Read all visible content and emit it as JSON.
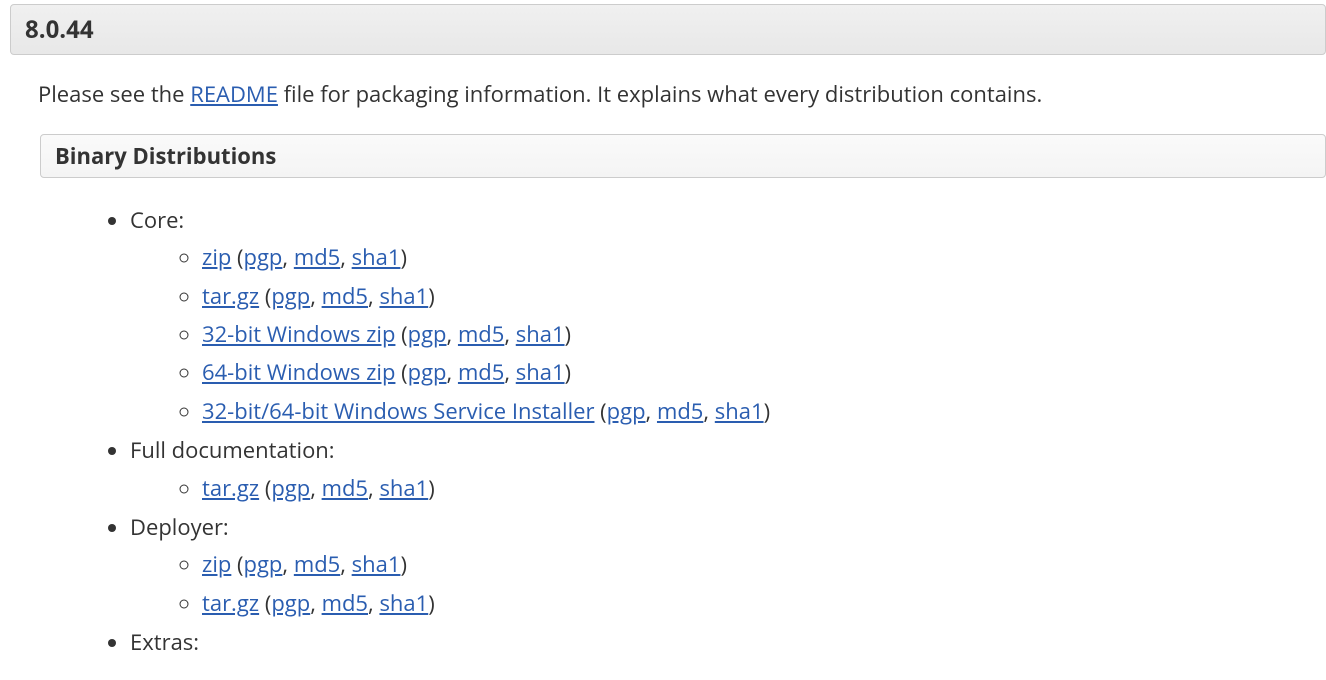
{
  "version": "8.0.44",
  "intro_prefix": "Please see the ",
  "readme_link": "README",
  "intro_suffix": " file for packaging information. It explains what every distribution contains.",
  "binary_header": "Binary Distributions",
  "categories": [
    {
      "label": "Core:",
      "items": [
        {
          "name": "zip",
          "sigs": [
            "pgp",
            "md5",
            "sha1"
          ]
        },
        {
          "name": "tar.gz",
          "sigs": [
            "pgp",
            "md5",
            "sha1"
          ]
        },
        {
          "name": "32-bit Windows zip",
          "sigs": [
            "pgp",
            "md5",
            "sha1"
          ]
        },
        {
          "name": "64-bit Windows zip",
          "sigs": [
            "pgp",
            "md5",
            "sha1"
          ]
        },
        {
          "name": "32-bit/64-bit Windows Service Installer",
          "sigs": [
            "pgp",
            "md5",
            "sha1"
          ]
        }
      ]
    },
    {
      "label": "Full documentation:",
      "items": [
        {
          "name": "tar.gz",
          "sigs": [
            "pgp",
            "md5",
            "sha1"
          ]
        }
      ]
    },
    {
      "label": "Deployer:",
      "items": [
        {
          "name": "zip",
          "sigs": [
            "pgp",
            "md5",
            "sha1"
          ]
        },
        {
          "name": "tar.gz",
          "sigs": [
            "pgp",
            "md5",
            "sha1"
          ]
        }
      ]
    },
    {
      "label": "Extras:",
      "items": []
    }
  ]
}
